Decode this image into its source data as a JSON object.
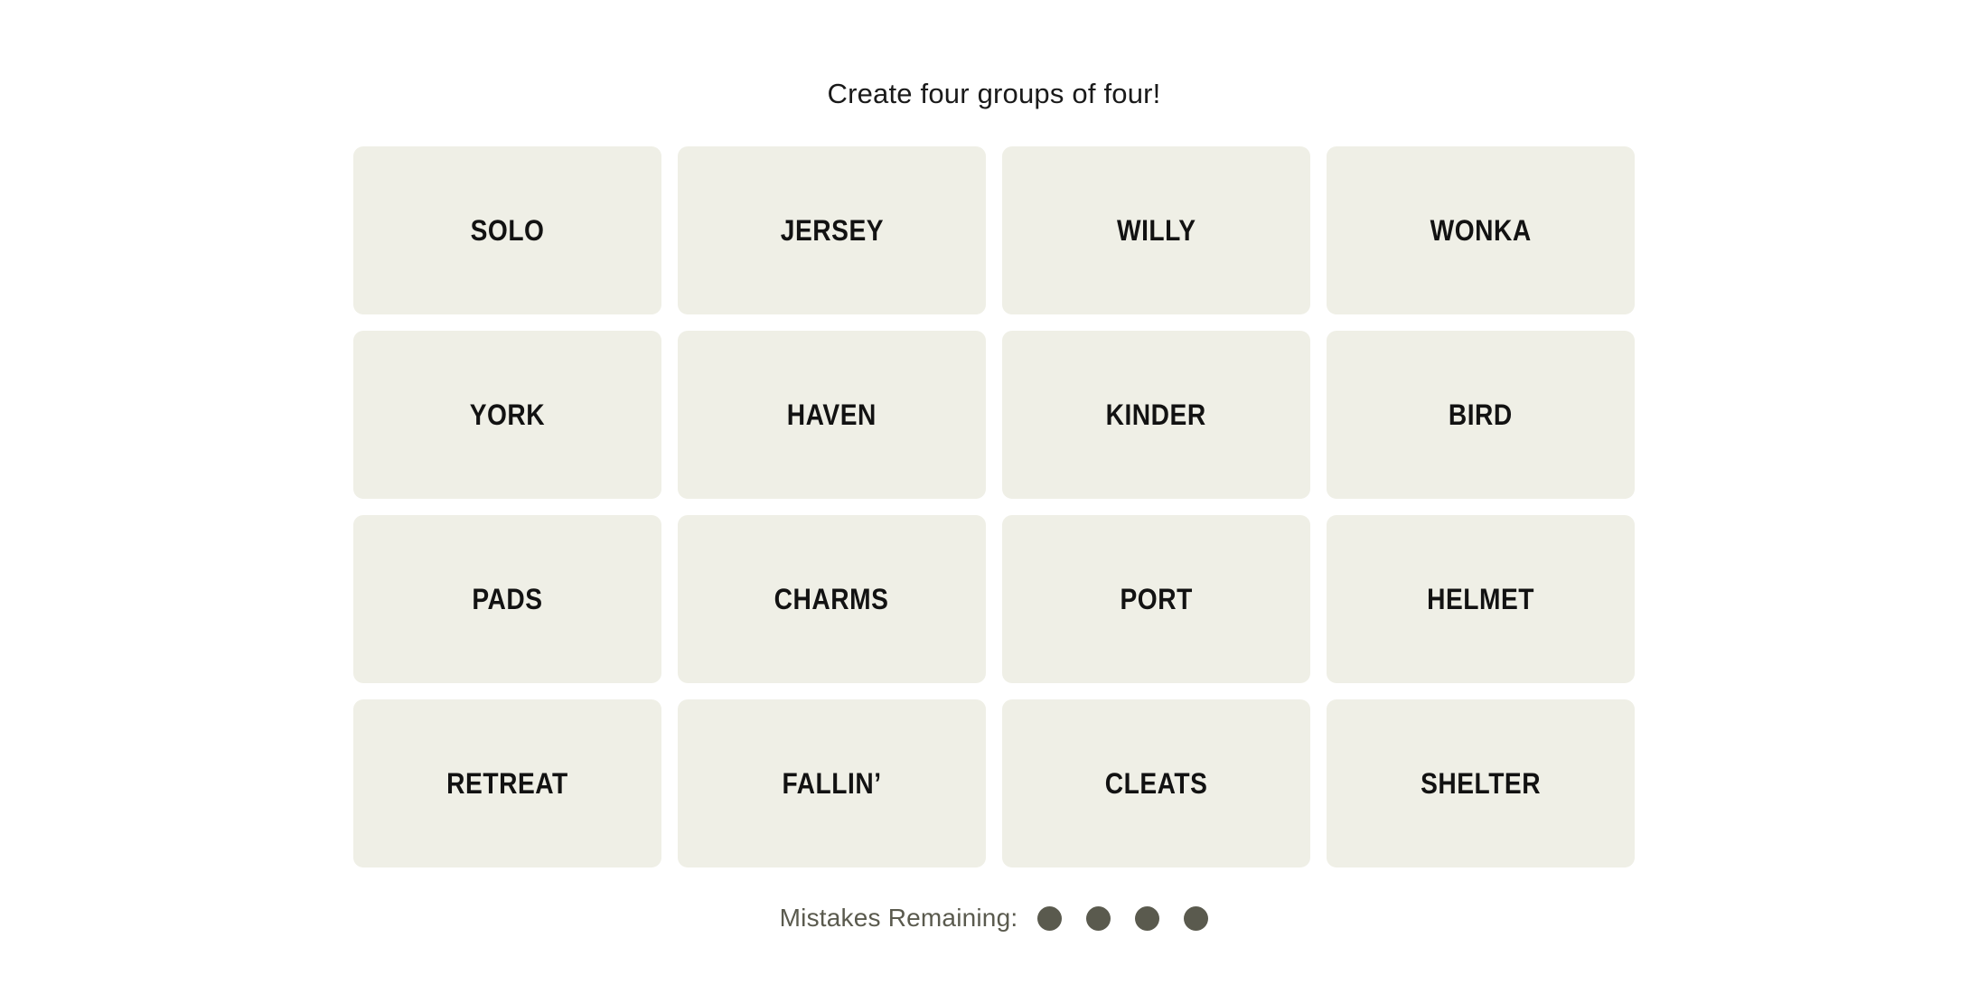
{
  "game": {
    "instruction": "Create four groups of four!",
    "board": {
      "rows": [
        {
          "tiles": [
            {
              "label": "SOLO"
            },
            {
              "label": "JERSEY"
            },
            {
              "label": "WILLY"
            },
            {
              "label": "WONKA"
            }
          ]
        },
        {
          "tiles": [
            {
              "label": "YORK"
            },
            {
              "label": "HAVEN"
            },
            {
              "label": "KINDER"
            },
            {
              "label": "BIRD"
            }
          ]
        },
        {
          "tiles": [
            {
              "label": "PADS"
            },
            {
              "label": "CHARMS"
            },
            {
              "label": "PORT"
            },
            {
              "label": "HELMET"
            }
          ]
        },
        {
          "tiles": [
            {
              "label": "RETREAT"
            },
            {
              "label": "FALLIN’"
            },
            {
              "label": "CLEATS"
            },
            {
              "label": "SHELTER"
            }
          ]
        }
      ]
    },
    "mistakes": {
      "label": "Mistakes Remaining:",
      "remaining": 4,
      "dots": [
        {
          "state": "filled"
        },
        {
          "state": "filled"
        },
        {
          "state": "filled"
        },
        {
          "state": "filled"
        }
      ]
    },
    "colors": {
      "page_background": "#FFFFFF",
      "tile_background": "#EFEFE6",
      "tile_text": "#121212",
      "instruction_text": "#1A1A1A",
      "mistakes_text": "#5A5A4E",
      "dot_fill": "#5A5A4E"
    }
  }
}
